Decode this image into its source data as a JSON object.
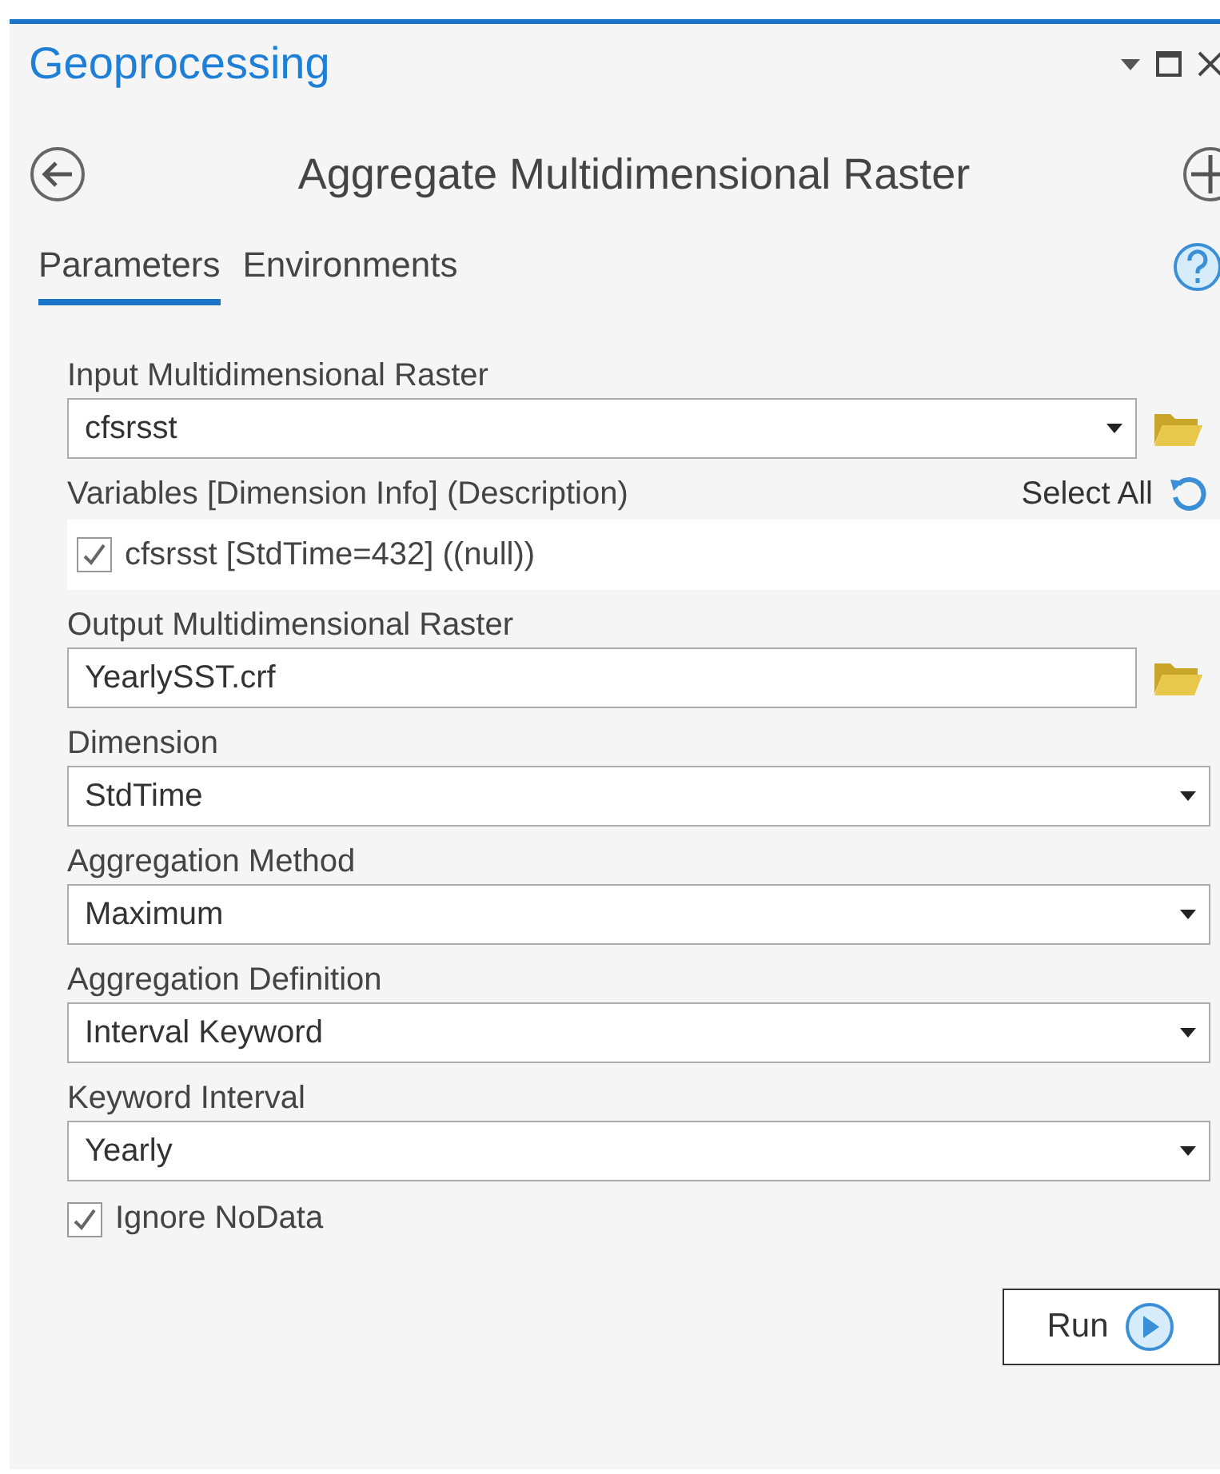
{
  "pane": {
    "title": "Geoprocessing",
    "tool_title": "Aggregate Multidimensional Raster"
  },
  "tabs": [
    {
      "label": "Parameters",
      "selected": true
    },
    {
      "label": "Environments",
      "selected": false
    }
  ],
  "parameters": [
    {
      "kind": "dropdown_browse",
      "label": "Input Multidimensional Raster",
      "value": "cfsrsst"
    },
    {
      "kind": "variables",
      "label": "Variables [Dimension Info] (Description)",
      "action": "Select All",
      "items": [
        {
          "text": "cfsrsst [StdTime=432] ((null))",
          "checked": true
        }
      ]
    },
    {
      "kind": "text_browse",
      "label": "Output Multidimensional Raster",
      "value": "YearlySST.crf"
    },
    {
      "kind": "dropdown",
      "label": "Dimension",
      "value": "StdTime"
    },
    {
      "kind": "dropdown",
      "label": "Aggregation Method",
      "value": "Maximum"
    },
    {
      "kind": "dropdown",
      "label": "Aggregation Definition",
      "value": "Interval Keyword"
    },
    {
      "kind": "dropdown",
      "label": "Keyword Interval",
      "value": "Yearly"
    },
    {
      "kind": "checkbox",
      "label": "Ignore NoData",
      "checked": true
    }
  ],
  "run_button": "Run"
}
